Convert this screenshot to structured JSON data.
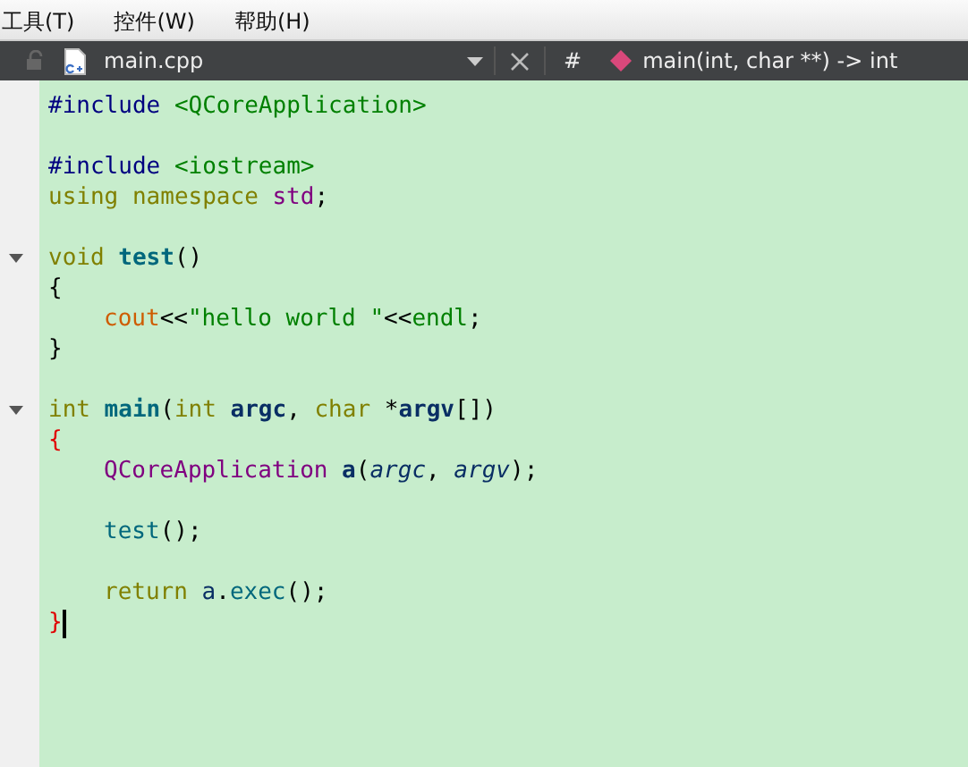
{
  "menu_bar": {
    "items": [
      "工具(T)",
      "控件(W)",
      "帮助(H)"
    ]
  },
  "editor_toolbar": {
    "file_name": "main.cpp",
    "symbol_prefix": "#",
    "current_symbol": "main(int, char **) -> int"
  },
  "code_lines": [
    {
      "tokens": [
        {
          "kind": "preproc",
          "text": "#include"
        },
        {
          "kind": "include",
          "text": " <QCoreApplication>"
        }
      ]
    },
    {
      "kind": "blank"
    },
    {
      "tokens": [
        {
          "kind": "preproc",
          "text": "#include"
        },
        {
          "kind": "include",
          "text": " <iostream>"
        }
      ]
    },
    {
      "tokens": [
        {
          "kind": "keyword",
          "text": "using namespace"
        },
        {
          "kind": "namespace",
          "text": " std"
        },
        {
          "kind": "plain",
          "text": ";"
        }
      ]
    },
    {
      "kind": "blank"
    },
    {
      "foldable": true,
      "tokens": [
        {
          "kind": "keyword",
          "text": "void"
        },
        {
          "kind": "function-decl",
          "text": " test"
        },
        {
          "kind": "plain",
          "text": "()"
        }
      ]
    },
    {
      "tokens": [
        {
          "kind": "plain",
          "text": "{"
        }
      ]
    },
    {
      "indented": true,
      "tokens": [
        {
          "kind": "global",
          "text": "cout"
        },
        {
          "kind": "plain",
          "text": "<<"
        },
        {
          "kind": "string",
          "text": "\"hello world \""
        },
        {
          "kind": "plain",
          "text": "<<"
        },
        {
          "kind": "string",
          "text": "endl"
        },
        {
          "kind": "plain",
          "text": ";"
        }
      ]
    },
    {
      "tokens": [
        {
          "kind": "plain",
          "text": "}"
        }
      ]
    },
    {
      "kind": "blank"
    },
    {
      "foldable": true,
      "tokens": [
        {
          "kind": "keyword",
          "text": "int"
        },
        {
          "kind": "function-decl",
          "text": " main"
        },
        {
          "kind": "plain",
          "text": "("
        },
        {
          "kind": "keyword",
          "text": "int"
        },
        {
          "kind": "param-decl",
          "text": " argc"
        },
        {
          "kind": "plain",
          "text": ","
        },
        {
          "kind": "keyword",
          "text": " char"
        },
        {
          "kind": "plain",
          "text": " *"
        },
        {
          "kind": "param-decl",
          "text": "argv"
        },
        {
          "kind": "plain",
          "text": "[])"
        }
      ]
    },
    {
      "tokens": [
        {
          "kind": "brace-match",
          "text": "{"
        }
      ]
    },
    {
      "indented": true,
      "tokens": [
        {
          "kind": "type",
          "text": "QCoreApplication"
        },
        {
          "kind": "local-decl",
          "text": " a"
        },
        {
          "kind": "plain",
          "text": "("
        },
        {
          "kind": "param",
          "text": "argc"
        },
        {
          "kind": "plain",
          "text": ","
        },
        {
          "kind": "param",
          "text": " argv"
        },
        {
          "kind": "plain",
          "text": ");"
        }
      ]
    },
    {
      "kind": "blank"
    },
    {
      "indented": true,
      "tokens": [
        {
          "kind": "function",
          "text": "test"
        },
        {
          "kind": "plain",
          "text": "();"
        }
      ]
    },
    {
      "kind": "blank"
    },
    {
      "indented": true,
      "tokens": [
        {
          "kind": "keyword",
          "text": "return"
        },
        {
          "kind": "local",
          "text": " a"
        },
        {
          "kind": "plain",
          "text": "."
        },
        {
          "kind": "function",
          "text": "exec"
        },
        {
          "kind": "plain",
          "text": "();"
        }
      ]
    },
    {
      "caret": true,
      "tokens": [
        {
          "kind": "brace-match",
          "text": "}"
        }
      ]
    }
  ]
}
